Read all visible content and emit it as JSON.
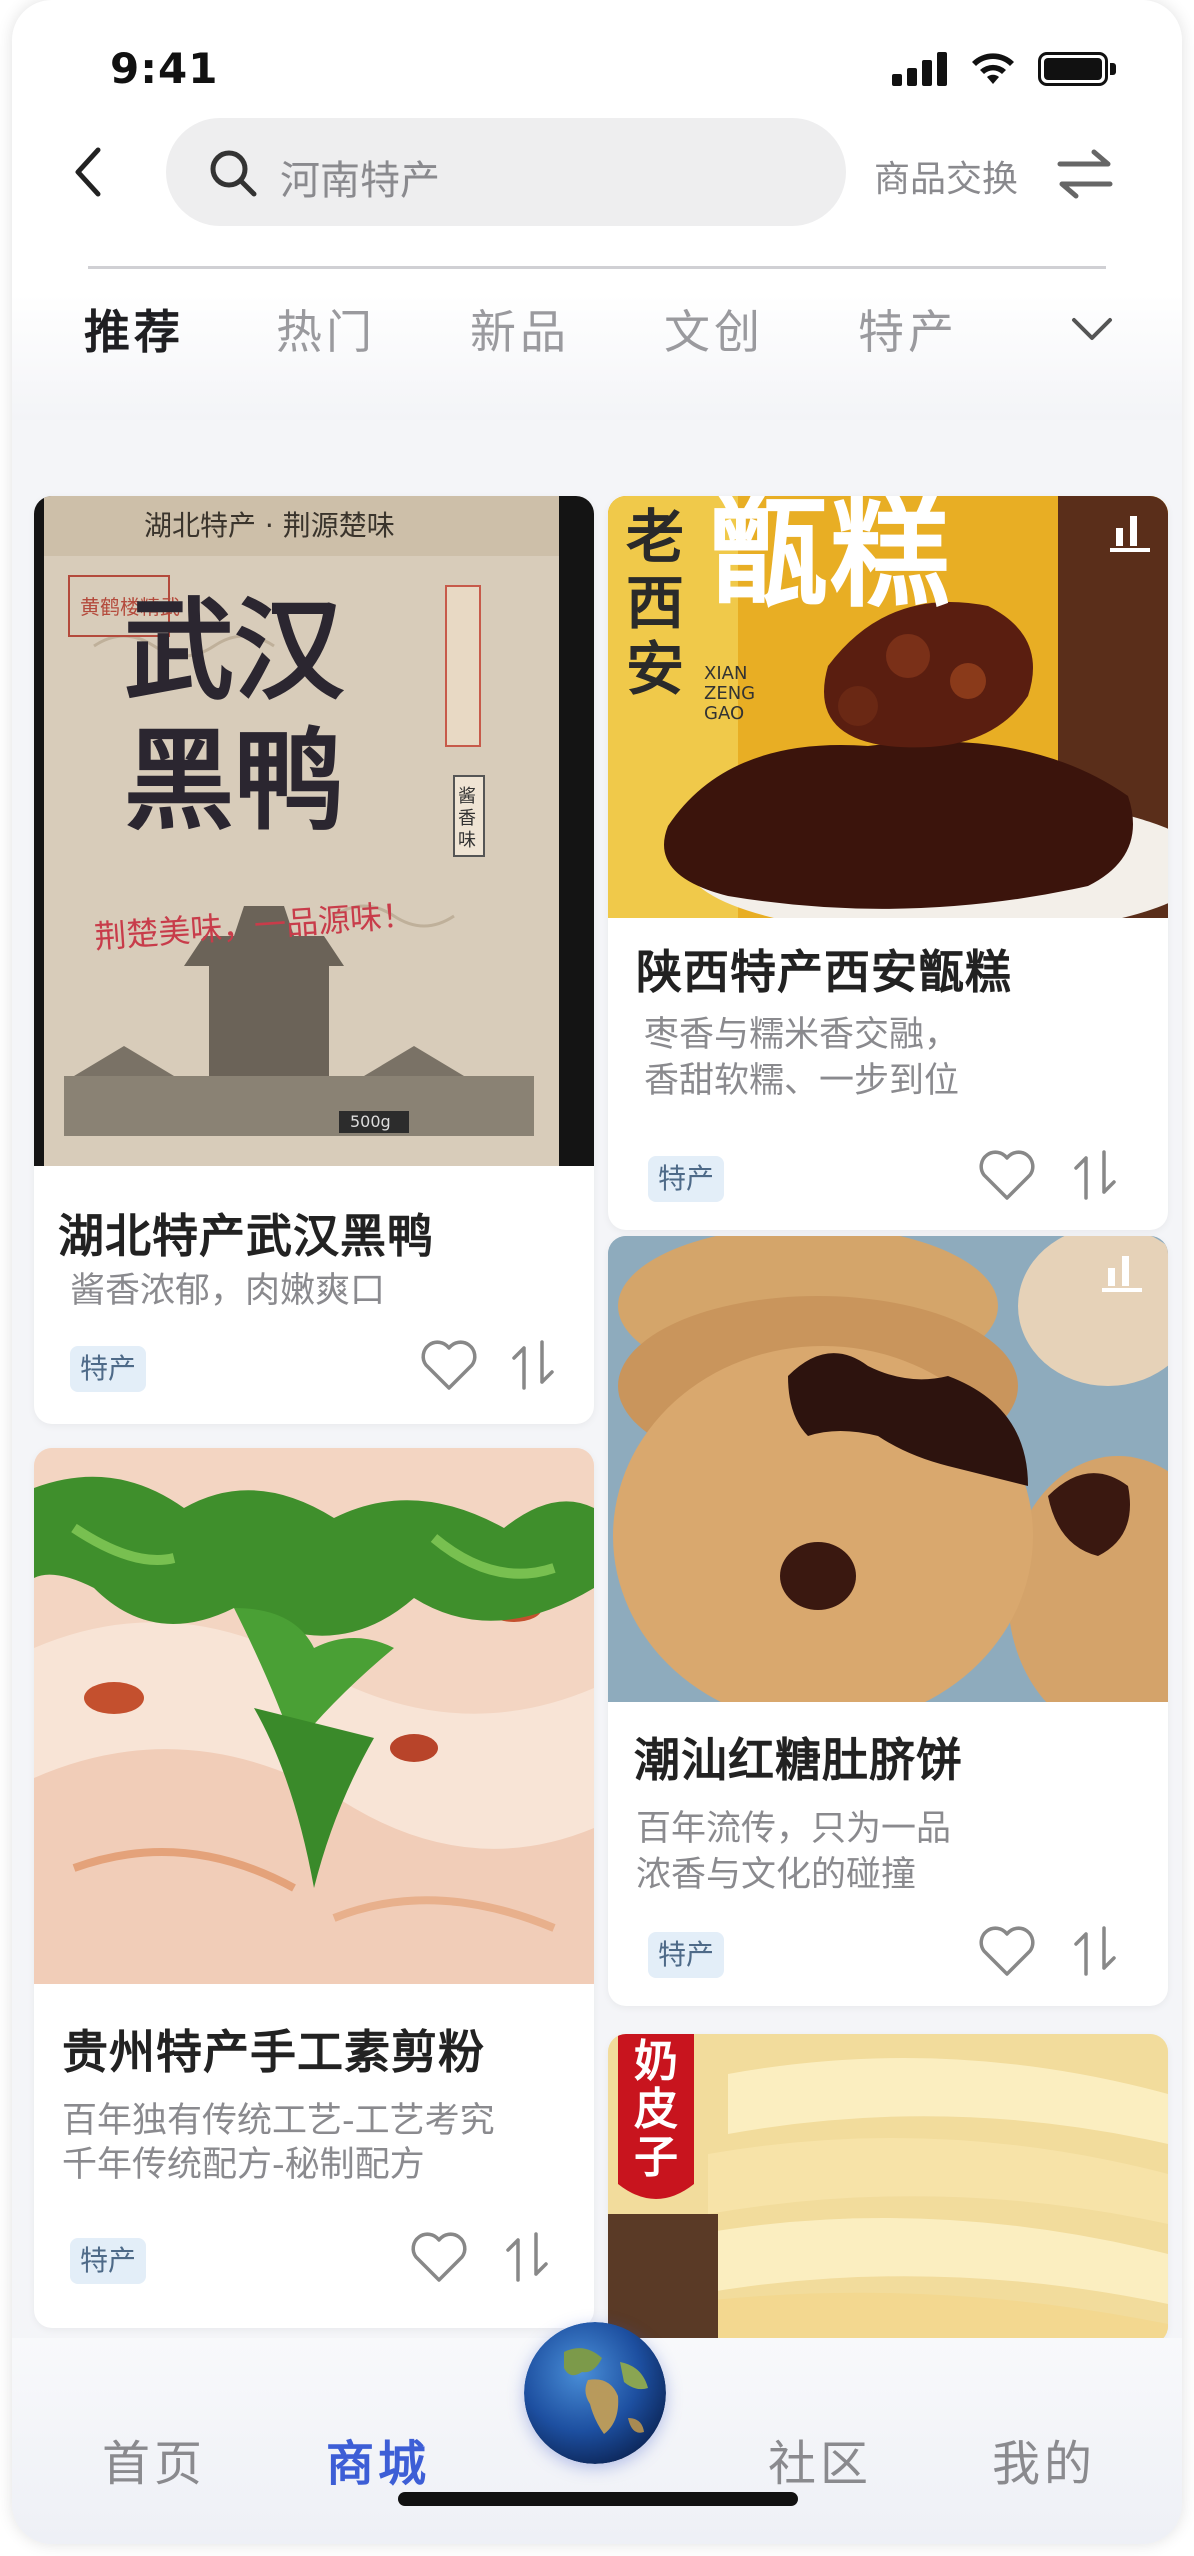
{
  "status_bar": {
    "time": "9:41"
  },
  "header": {
    "search_placeholder": "河南特产",
    "exchange_label": "商品交换"
  },
  "tabs": [
    {
      "label": "推荐",
      "active": true
    },
    {
      "label": "热门",
      "active": false
    },
    {
      "label": "新品",
      "active": false
    },
    {
      "label": "文创",
      "active": false
    },
    {
      "label": "特产",
      "active": false
    }
  ],
  "products": [
    {
      "title": "湖北特产武汉黑鸭",
      "desc": [
        "酱香浓郁，肉嫩爽口"
      ],
      "tag": "特产",
      "image_text": {
        "top": "湖北特产 · 荆源楚味",
        "brand": "黄鹤楼精武",
        "name": "武汉黑鸭",
        "slogan": "荆楚美味，一品源味！",
        "side": "酱香味",
        "weight": "500g"
      }
    },
    {
      "title": "陕西特产西安甑糕",
      "desc": [
        "枣香与糯米香交融，",
        "香甜软糯、一步到位"
      ],
      "tag": "特产",
      "image_text": {
        "vertical": "老西安",
        "big": "甑糕",
        "pinyin": "XIAN ZENG GAO"
      }
    },
    {
      "title": "潮汕红糖肚脐饼",
      "desc": [
        "百年流传，只为一品",
        "浓香与文化的碰撞"
      ],
      "tag": "特产"
    },
    {
      "title": "贵州特产手工素剪粉",
      "desc": [
        "百年独有传统工艺-工艺考究",
        "千年传统配方-秘制配方"
      ],
      "tag": "特产"
    },
    {
      "title": "",
      "image_text": {
        "badge": "奶皮子"
      }
    }
  ],
  "bottom_nav": [
    {
      "label": "首页",
      "active": false
    },
    {
      "label": "商城",
      "active": true
    },
    {
      "label": "社区",
      "active": false
    },
    {
      "label": "我的",
      "active": false
    }
  ],
  "colors": {
    "accent": "#3d5ed6",
    "tag_bg": "#e3eef8",
    "background": "#f4f5f8"
  }
}
